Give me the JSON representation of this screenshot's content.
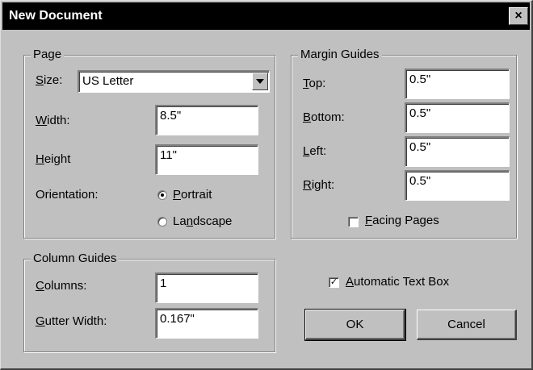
{
  "window": {
    "title": "New Document",
    "close_glyph": "×"
  },
  "page_group": {
    "legend": "Page",
    "size_label_mn": "S",
    "size_label_rest": "ize:",
    "size_value": "US Letter",
    "width_label_mn": "W",
    "width_label_rest": "idth:",
    "width_value": "8.5\"",
    "height_label_mn": "H",
    "height_label_rest": "eight",
    "height_value": "11\"",
    "orientation_label": "Orientation:",
    "portrait_mn": "P",
    "portrait_rest": "ortrait",
    "landscape_pre": "La",
    "landscape_mn": "n",
    "landscape_rest": "dscape",
    "orientation_selected": "portrait"
  },
  "margin_group": {
    "legend": "Margin Guides",
    "top_mn": "T",
    "top_rest": "op:",
    "top_value": "0.5\"",
    "bottom_mn": "B",
    "bottom_rest": "ottom:",
    "bottom_value": "0.5\"",
    "left_mn": "L",
    "left_rest": "eft:",
    "left_value": "0.5\"",
    "right_mn": "R",
    "right_rest": "ight:",
    "right_value": "0.5\"",
    "facing_mn": "F",
    "facing_rest": "acing Pages",
    "facing_checked": false
  },
  "column_group": {
    "legend": "Column Guides",
    "columns_mn": "C",
    "columns_rest": "olumns:",
    "columns_value": "1",
    "gutter_mn": "G",
    "gutter_rest": "utter Width:",
    "gutter_value": "0.167\""
  },
  "auto_textbox": {
    "mn": "A",
    "rest": "utomatic Text Box",
    "checked": true,
    "check_glyph": "✓"
  },
  "buttons": {
    "ok": "OK",
    "cancel": "Cancel"
  }
}
